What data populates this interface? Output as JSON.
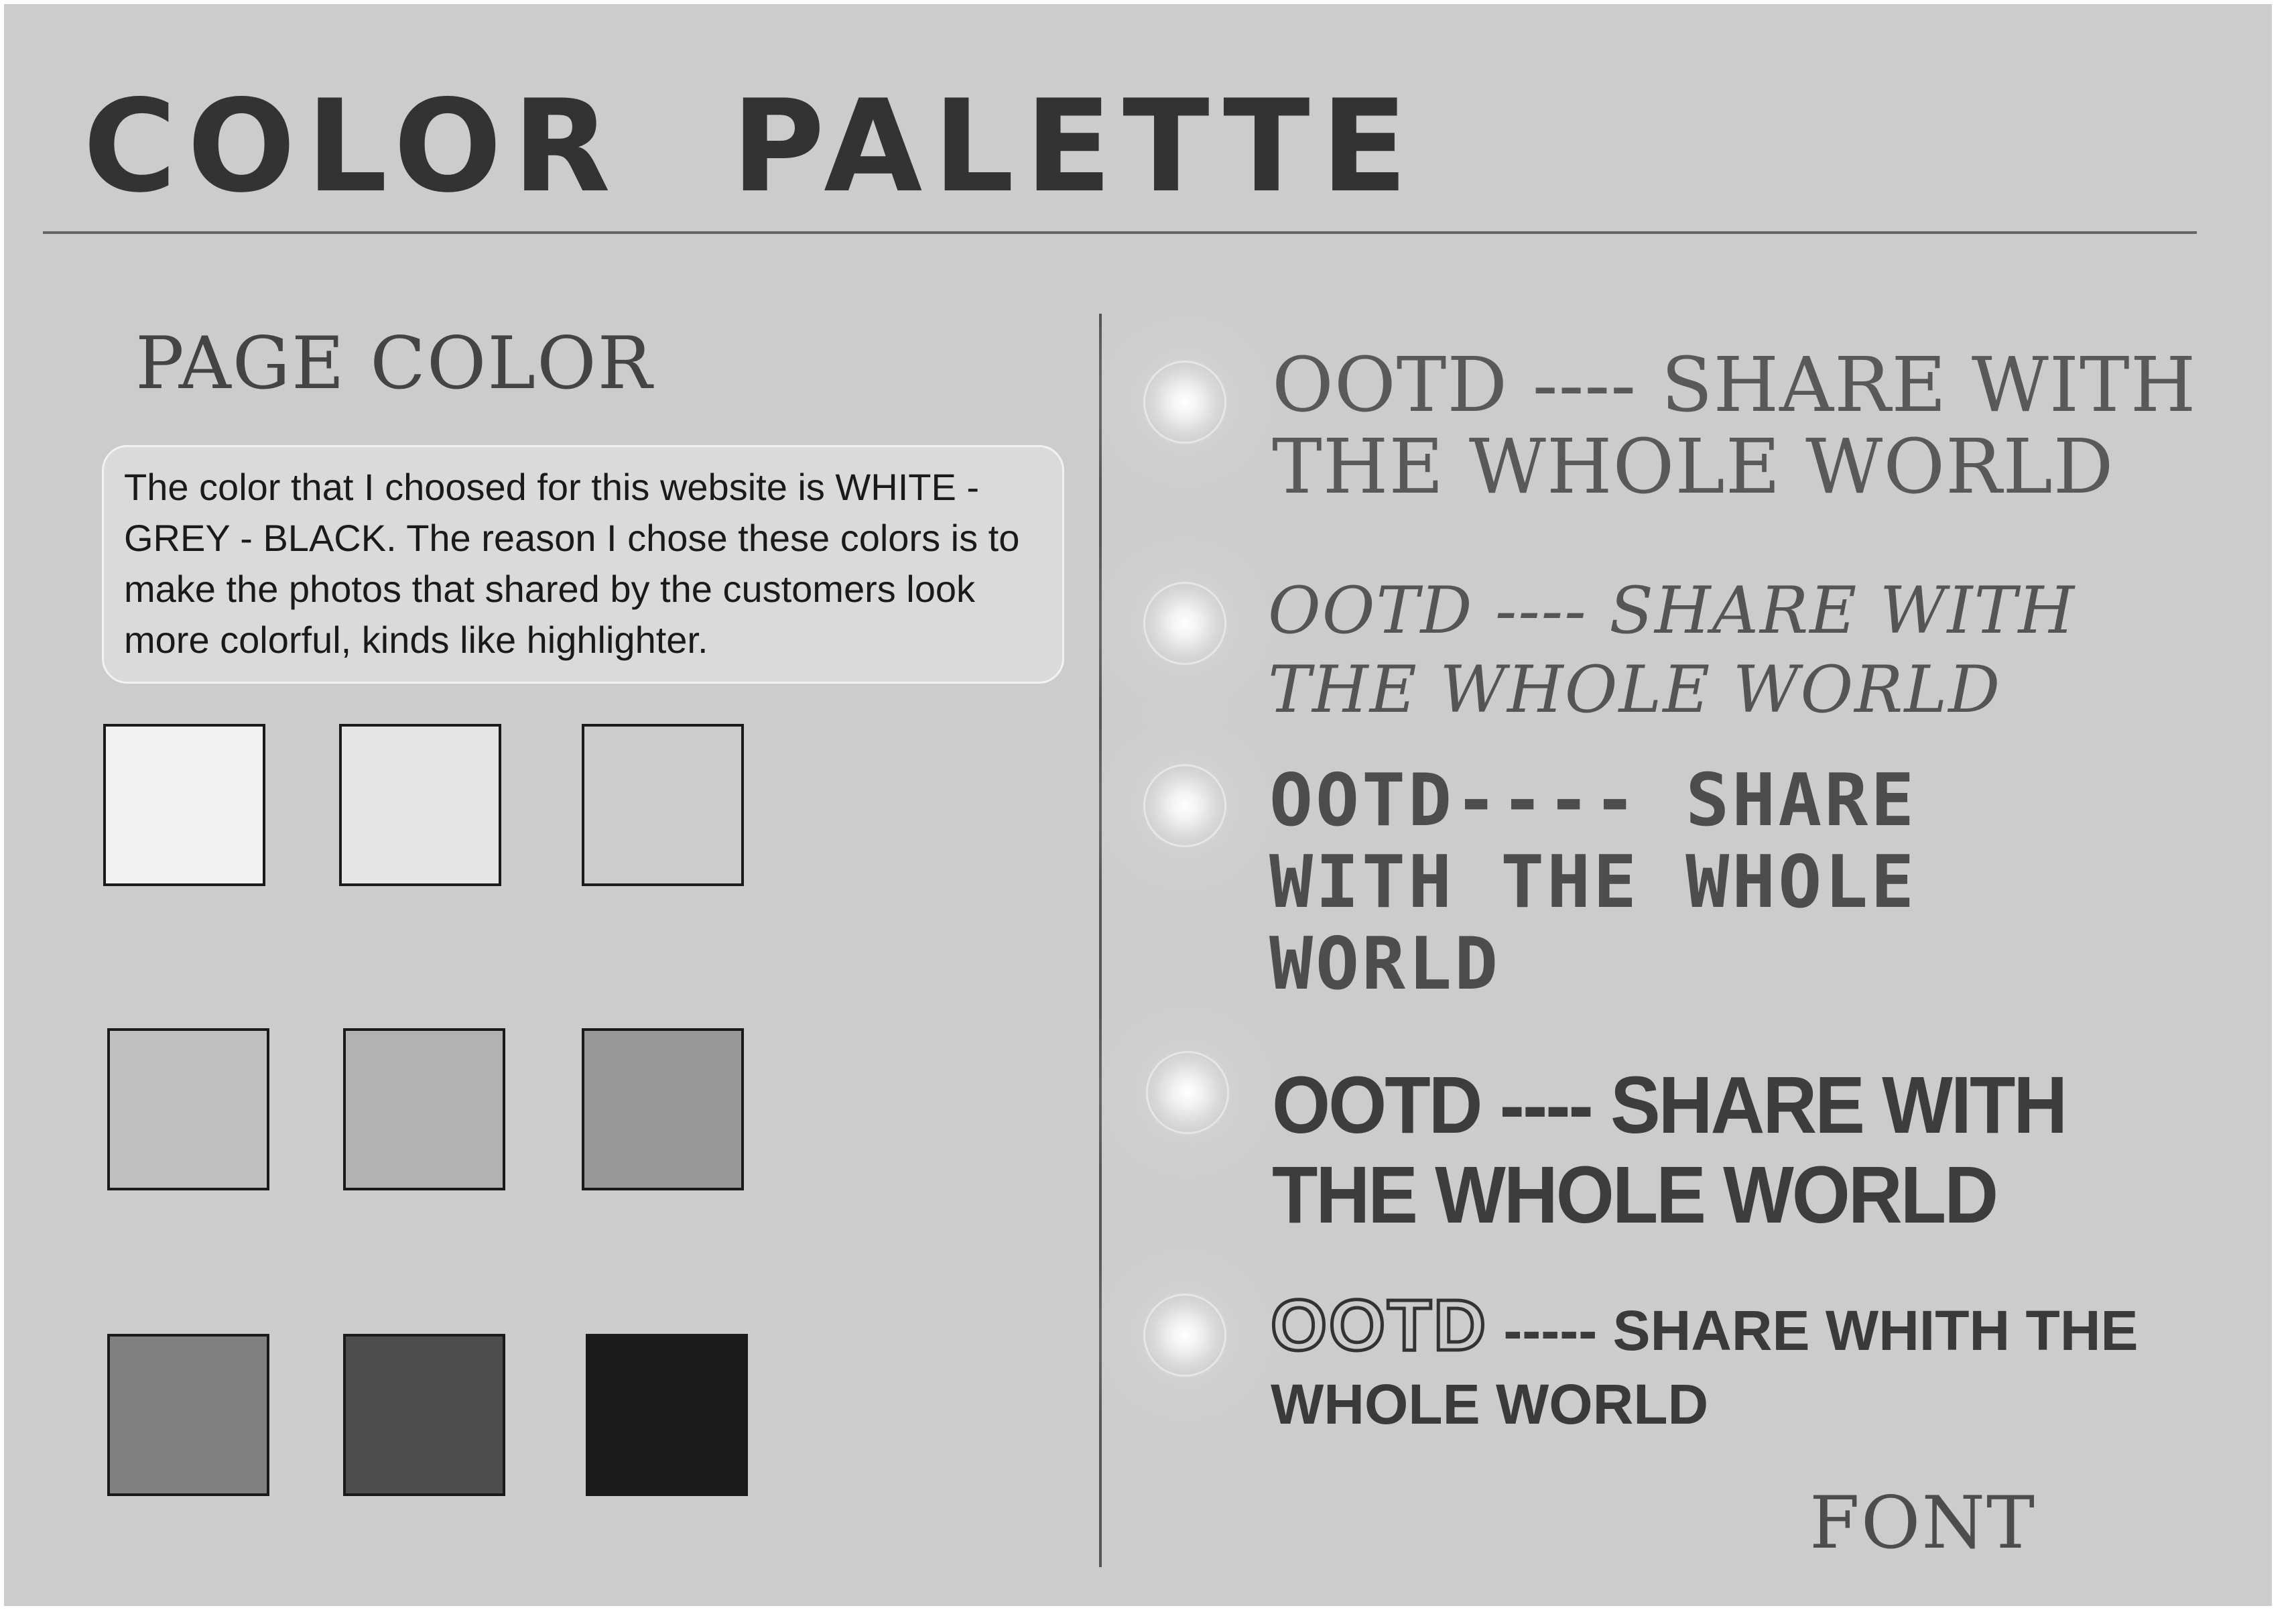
{
  "title": "COLOR  PALETTE",
  "page_color": {
    "heading": "PAGE COLOR",
    "description": "The color that I choosed for this website is WHITE - GREY - BLACK. The reason I chose these colors is to make the photos that shared by the customers look more colorful, kinds like highlighter."
  },
  "swatches": [
    "#f2f2f2",
    "#e6e6e6",
    "#cccccc",
    "#bfbfbf",
    "#b2b2b2",
    "#999999",
    "#808080",
    "#4d4d4d",
    "#1a1a1a"
  ],
  "font_samples": {
    "s1": "OOTD ---- SHARE WITH THE WHOLE WORLD",
    "s2": "OOTD ---- SHARE WITH THE WHOLE WORLD",
    "s3": "OOTD---- SHARE WITH THE WHOLE WORLD",
    "s4": "OOTD ---- SHARE WITH THE WHOLE WORLD",
    "s5": {
      "ootd": "OOTD",
      "dashes": "-----",
      "rest": "SHARE WHITH THE WHOLE WORLD"
    }
  },
  "font_heading": "FONT"
}
